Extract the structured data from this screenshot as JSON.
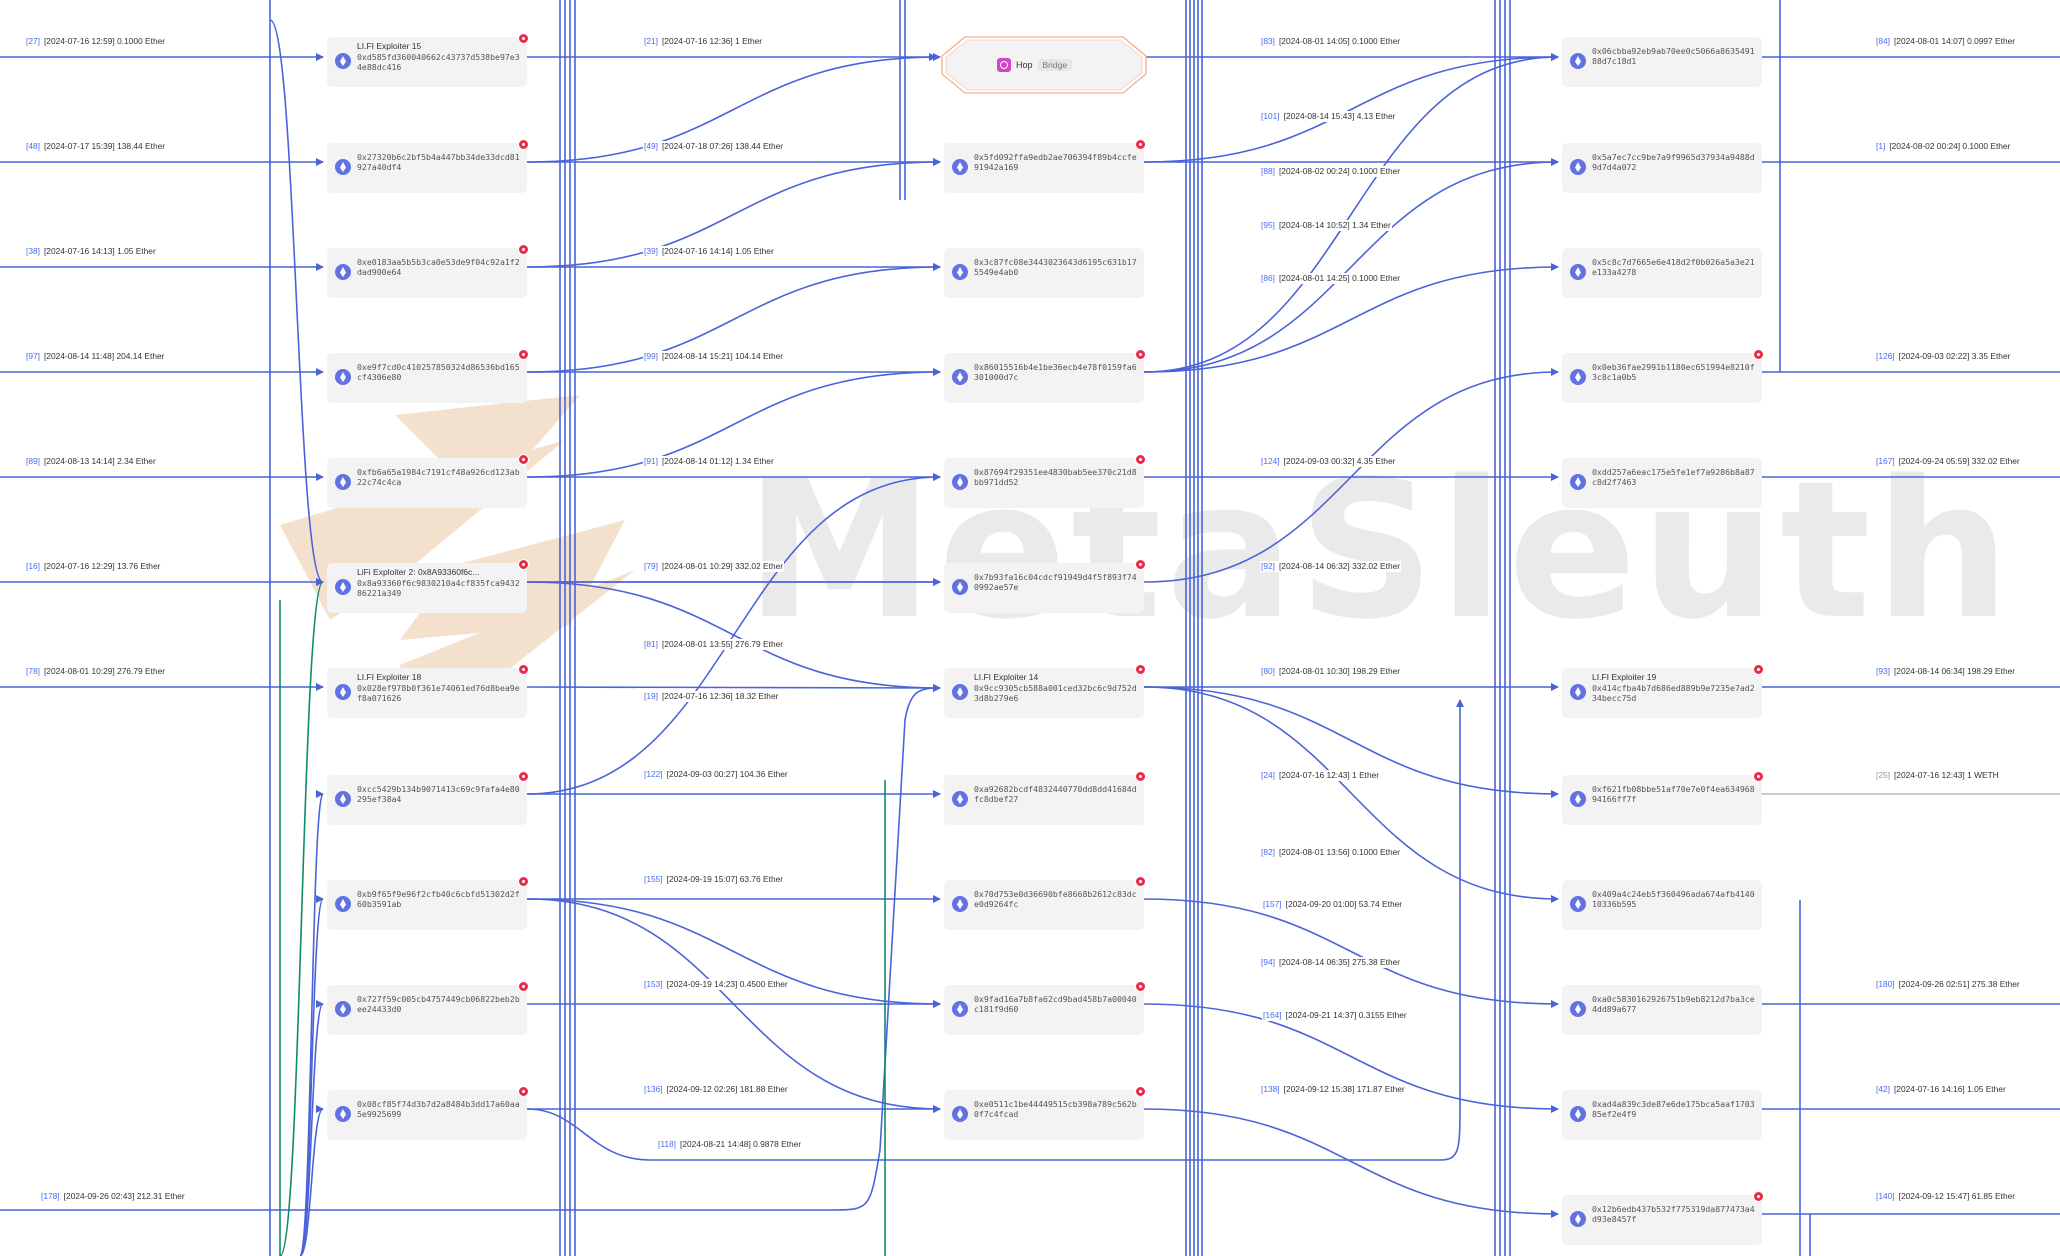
{
  "watermark": {
    "text": "MetaSleuth"
  },
  "colors": {
    "edge": "#4a63d8",
    "edge_green": "#0f8b6e",
    "edge_gray": "#b9b9b9",
    "flag": "#ea2a4a",
    "eth": "#6272e3",
    "hop": "#d146c8"
  },
  "bridge": {
    "name": "Hop",
    "tag": "Bridge",
    "icon": "hop-bridge-icon"
  },
  "nodes": [
    {
      "name": "LI.FI Exploiter 15",
      "addr": "0xd585fd360040662c43737d538be97e34e88dc416",
      "flag": true,
      "kind": "labeled"
    },
    {
      "name": "",
      "addr": "0x27320b6c2bf5b4a447bb34de33dcd81927a40df4",
      "flag": true
    },
    {
      "name": "",
      "addr": "0xe0183aa5b5b3ca0e53de9f04c92a1f2dad900e64",
      "flag": true
    },
    {
      "name": "",
      "addr": "0xe9f7cd0c410257850324d86536bd165cf4306e80",
      "flag": true
    },
    {
      "name": "",
      "addr": "0xfb6a65a1984c7191cf48a926cd123ab22c74c4ca",
      "flag": true
    },
    {
      "name": "LiFi Exploiter 2: 0x8A93360f6c...",
      "addr": "0x8a93360f6c9830210a4cf835fca943286221a349",
      "flag": true
    },
    {
      "name": "LI.FI Exploiter 18",
      "addr": "0x028ef978b0f361e74061ed76d8bea9ef8a071626",
      "flag": true
    },
    {
      "name": "",
      "addr": "0xcc5429b134b9071413c69c9fafa4e80295ef38a4",
      "flag": true
    },
    {
      "name": "",
      "addr": "0xb9f65f9e96f2cfb40c6cbfd51302d2f60b3591ab",
      "flag": true
    },
    {
      "name": "",
      "addr": "0x727f59c005cb4757449cb06822beb2bee24433d0",
      "flag": true
    },
    {
      "name": "",
      "addr": "0x08cf85f74d3b7d2a8484b3dd17a60aa5e9925699",
      "flag": true
    },
    {
      "name": "",
      "addr": "0x5fd092ffa9edb2ae706394f89b4ccfe91942a169",
      "flag": true
    },
    {
      "name": "",
      "addr": "0x3c87fc08e3443023643d6195c631b175549e4ab0",
      "flag": false
    },
    {
      "name": "",
      "addr": "0x86015516b4e1be36ecb4e78f0159fa6301000d7c",
      "flag": true
    },
    {
      "name": "",
      "addr": "0x87694f29351ee4830bab5ee370c21d8bb971dd52",
      "flag": true
    },
    {
      "name": "",
      "addr": "0x7b93fa16c04cdcf91949d4f5f893f740992ae57e",
      "flag": true
    },
    {
      "name": "LI.FI Exploiter 14",
      "addr": "0x9cc9305cb588a001ced32bc6c9d752d3d8b279e6",
      "flag": true
    },
    {
      "name": "",
      "addr": "0xa92682bcdf4832440770dd8dd41684dfc8dbef27",
      "flag": true
    },
    {
      "name": "",
      "addr": "0x70d753e0d36690bfe8668b2612c83dce0d9264fc",
      "flag": true
    },
    {
      "name": "",
      "addr": "0x9fad16a7b8fa62cd9bad458b7a00040c181f9d60",
      "flag": true
    },
    {
      "name": "",
      "addr": "0xe0511c1be44449515cb398a789c562b0f7c4fcad",
      "flag": true
    },
    {
      "name": "",
      "addr": "0x06cbba92eb9ab70ee0c5066a863549188d7c18d1",
      "flag": false
    },
    {
      "name": "",
      "addr": "0x5a7ec7cc9be7a9f9965d37934a9488d9d7d4a072",
      "flag": false
    },
    {
      "name": "",
      "addr": "0x5c8c7d7665e6e418d2f0b026a5a3e21e133a4278",
      "flag": false
    },
    {
      "name": "",
      "addr": "0x0eb36fae2991b1180ec651994e8210f3c8c1a0b5",
      "flag": true
    },
    {
      "name": "",
      "addr": "0xdd257a6eac175e5fe1ef7a9286b8a87c8d2f7463",
      "flag": false
    },
    {
      "name": "LI.FI Exploiter 19",
      "addr": "0x414cfba4b7d686ed889b9e7235e7ad234becc75d",
      "flag": true
    },
    {
      "name": "",
      "addr": "0xf621fb08bbe51af70e7e0f4ea63496894166ff7f",
      "flag": true
    },
    {
      "name": "",
      "addr": "0x409a4c24eb5f360496ada674afb414010336b595",
      "flag": false
    },
    {
      "name": "",
      "addr": "0xa0c5830162926751b9eb8212d7ba3ce4dd89a677",
      "flag": false
    },
    {
      "name": "",
      "addr": "0xad4a839c3de87e6de175bca5aaf170385ef2e4f9",
      "flag": false
    },
    {
      "name": "",
      "addr": "0x12b6edb437b532f775319da877473a4d93e8457f",
      "flag": true
    }
  ],
  "edge_labels": [
    {
      "id": "[27]",
      "text": "[2024-07-16 12:59] 0.1000 Ether"
    },
    {
      "id": "[48]",
      "text": "[2024-07-17 15:39] 138.44 Ether"
    },
    {
      "id": "[38]",
      "text": "[2024-07-16 14:13] 1.05 Ether"
    },
    {
      "id": "[97]",
      "text": "[2024-08-14 11:48] 204.14 Ether"
    },
    {
      "id": "[89]",
      "text": "[2024-08-13 14:14] 2.34 Ether"
    },
    {
      "id": "[16]",
      "text": "[2024-07-16 12:29] 13.76 Ether"
    },
    {
      "id": "[78]",
      "text": "[2024-08-01 10:29] 276.79 Ether"
    },
    {
      "id": "[178]",
      "text": "[2024-09-26 02:43] 212.31 Ether"
    },
    {
      "id": "[21]",
      "text": "[2024-07-16 12:36] 1 Ether"
    },
    {
      "id": "[49]",
      "text": "[2024-07-18 07:26] 138.44 Ether"
    },
    {
      "id": "[39]",
      "text": "[2024-07-16 14:14] 1.05 Ether"
    },
    {
      "id": "[99]",
      "text": "[2024-08-14 15:21] 104.14 Ether"
    },
    {
      "id": "[91]",
      "text": "[2024-08-14 01:12] 1.34 Ether"
    },
    {
      "id": "[79]",
      "text": "[2024-08-01 10:29] 332.02 Ether"
    },
    {
      "id": "[81]",
      "text": "[2024-08-01 13:55] 276.79 Ether"
    },
    {
      "id": "[19]",
      "text": "[2024-07-16 12:36] 18.32 Ether"
    },
    {
      "id": "[122]",
      "text": "[2024-09-03 00:27] 104.36 Ether"
    },
    {
      "id": "[155]",
      "text": "[2024-09-19 15:07] 63.76 Ether"
    },
    {
      "id": "[153]",
      "text": "[2024-09-19 14:23] 0.4500 Ether"
    },
    {
      "id": "[136]",
      "text": "[2024-09-12 02:26] 181.88 Ether"
    },
    {
      "id": "[118]",
      "text": "[2024-08-21 14:48] 0.9878 Ether"
    },
    {
      "id": "[83]",
      "text": "[2024-08-01 14:05] 0.1000 Ether"
    },
    {
      "id": "[101]",
      "text": "[2024-08-14 15:43] 4.13 Ether"
    },
    {
      "id": "[88]",
      "text": "[2024-08-02 00:24] 0.1000 Ether"
    },
    {
      "id": "[95]",
      "text": "[2024-08-14 10:52] 1.34 Ether"
    },
    {
      "id": "[86]",
      "text": "[2024-08-01 14:25] 0.1000 Ether"
    },
    {
      "id": "[124]",
      "text": "[2024-09-03 00:32] 4.35 Ether"
    },
    {
      "id": "[92]",
      "text": "[2024-08-14 06:32] 332.02 Ether"
    },
    {
      "id": "[80]",
      "text": "[2024-08-01 10:30] 198.29 Ether"
    },
    {
      "id": "[24]",
      "text": "[2024-07-16 12:43] 1 Ether"
    },
    {
      "id": "[82]",
      "text": "[2024-08-01 13:56] 0.1000 Ether"
    },
    {
      "id": "[157]",
      "text": "[2024-09-20 01:00] 53.74 Ether"
    },
    {
      "id": "[94]",
      "text": "[2024-08-14 06:35] 275.38 Ether"
    },
    {
      "id": "[164]",
      "text": "[2024-09-21 14:37] 0.3155 Ether"
    },
    {
      "id": "[138]",
      "text": "[2024-09-12 15:38] 171.87 Ether"
    },
    {
      "id": "[84]",
      "text": "[2024-08-01 14:07] 0.0997 Ether"
    },
    {
      "id": "[1]",
      "text": "[2024-08-02 00:24] 0.1000 Ether"
    },
    {
      "id": "[126]",
      "text": "[2024-09-03 02:22] 3.35 Ether"
    },
    {
      "id": "[167]",
      "text": "[2024-09-24 05:59] 332.02 Ether"
    },
    {
      "id": "[93]",
      "text": "[2024-08-14 06:34] 198.29 Ether"
    },
    {
      "id": "[25]",
      "text": "[2024-07-16 12:43] 1 WETH",
      "gray": true
    },
    {
      "id": "[180]",
      "text": "[2024-09-26 02:51] 275.38 Ether"
    },
    {
      "id": "[42]",
      "text": "[2024-07-16 14:16] 1.05 Ether"
    },
    {
      "id": "[140]",
      "text": "[2024-09-12 15:47] 61.85 Ether"
    }
  ]
}
